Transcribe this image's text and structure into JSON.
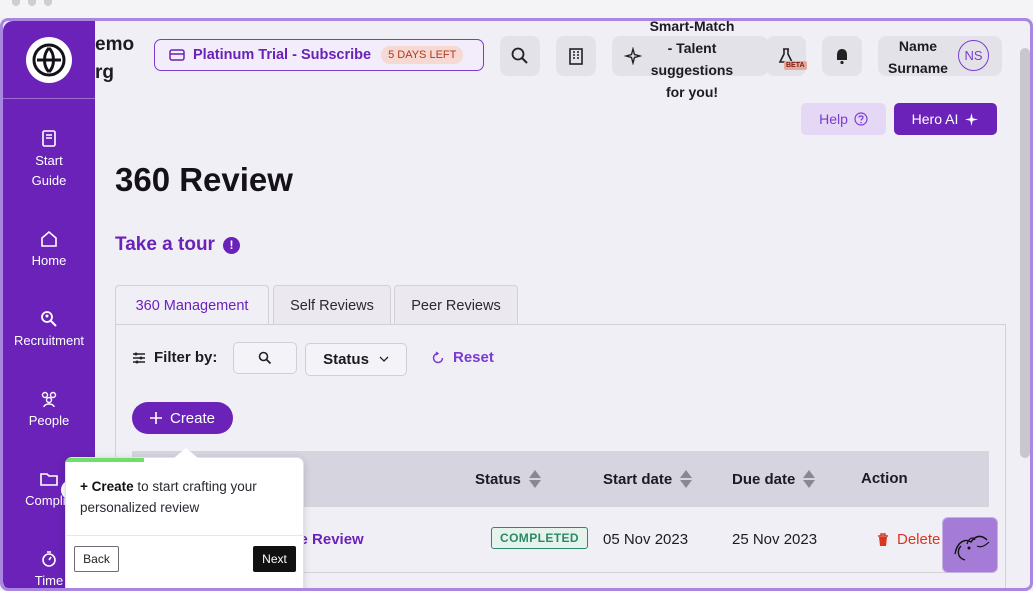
{
  "header": {
    "org_name_line1": "emo",
    "org_name_line2": "rg",
    "trial_label": "Platinum Trial - Subscribe",
    "trial_badge": "5 DAYS LEFT",
    "smart_match_lines": [
      "Smart-Match",
      "- Talent",
      "suggestions",
      "for you!"
    ],
    "beta_badge": "BETA",
    "user_name_line1": "Name",
    "user_name_line2": "Surname",
    "user_initials": "NS",
    "help_label": "Help",
    "hero_ai_label": "Hero AI"
  },
  "sidebar": {
    "items": [
      {
        "label_line1": "Start",
        "label_line2": "Guide"
      },
      {
        "label_line1": "Home"
      },
      {
        "label_line1": "Recruitment"
      },
      {
        "label_line1": "People"
      },
      {
        "label_line1": "Complia"
      },
      {
        "label_line1": "Time"
      }
    ]
  },
  "page": {
    "title": "360 Review",
    "tour_label": "Take a tour",
    "tour_info": "!"
  },
  "tabs": [
    {
      "label": "360 Management",
      "active": true
    },
    {
      "label": "Self Reviews",
      "active": false
    },
    {
      "label": "Peer Reviews",
      "active": false
    }
  ],
  "filters": {
    "filter_label": "Filter by:",
    "status_label": "Status",
    "reset_label": "Reset"
  },
  "create_label": "Create",
  "table": {
    "columns": [
      "Status",
      "Start date",
      "Due date",
      "Action"
    ],
    "rows": [
      {
        "name": "nce Review",
        "status": "COMPLETED",
        "start_date": "05 Nov 2023",
        "due_date": "25 Nov 2023",
        "action": "Delete"
      }
    ]
  },
  "tooltip": {
    "bold_text": "+ Create",
    "text": " to start crafting your personalized review",
    "back_label": "Back",
    "next_label": "Next",
    "progress": 0.33
  },
  "colors": {
    "primary": "#6a22b8",
    "accent_light": "#e5d8f5",
    "success": "#2a8a68",
    "danger": "#d8371f"
  }
}
